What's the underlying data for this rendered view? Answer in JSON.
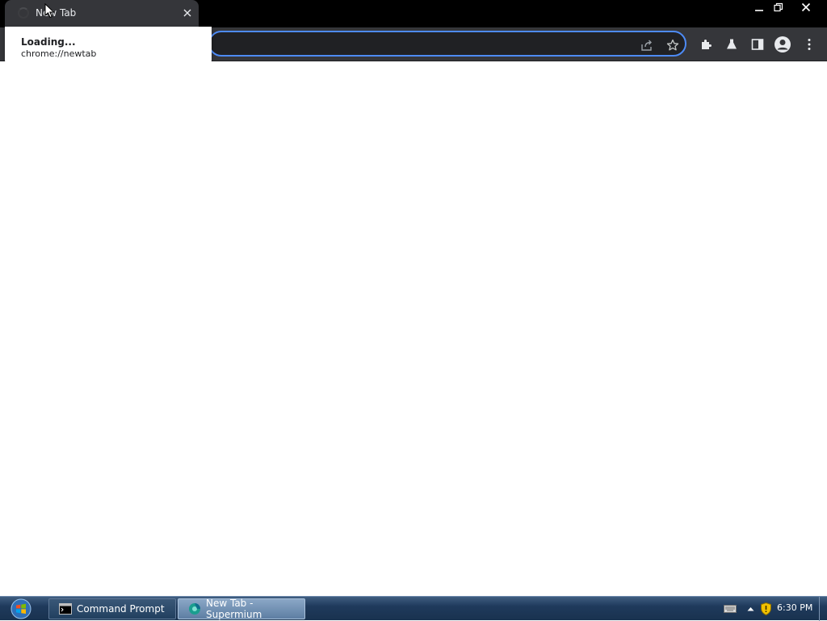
{
  "browser": {
    "tab": {
      "title": "New Tab",
      "spinner_icon": "loading-spinner-icon",
      "close_icon": "close-icon"
    },
    "window_controls": {
      "minimize_icon": "minimize-icon",
      "restore_icon": "restore-icon",
      "close_icon": "close-icon"
    },
    "omnibox": {
      "value": "",
      "share_icon": "share-icon",
      "bookmark_icon": "star-icon"
    },
    "toolbar": {
      "extensions_icon": "puzzle-icon",
      "labs_icon": "flask-icon",
      "side_panel_icon": "side-panel-icon",
      "profile_icon": "profile-avatar-icon",
      "menu_icon": "kebab-menu-icon"
    },
    "hover_card": {
      "title": "Loading...",
      "url": "chrome://newtab"
    }
  },
  "taskbar": {
    "start_icon": "windows-orb-icon",
    "tasks": [
      {
        "label": "Command Prompt",
        "icon": "cmd-icon"
      },
      {
        "label": "New Tab - Supermium",
        "icon": "supermium-icon"
      }
    ],
    "tray": {
      "keyboard_icon": "keyboard-icon",
      "arrow_icon": "chevron-up-icon",
      "shield_icon": "shield-icon"
    },
    "clock": "6:30 PM"
  },
  "colors": {
    "frame": "#000000",
    "toolbar": "#35363a",
    "omnibox_bg": "#202124",
    "focus_ring": "#4d8bf6",
    "taskbar": "#1f3a5c"
  }
}
